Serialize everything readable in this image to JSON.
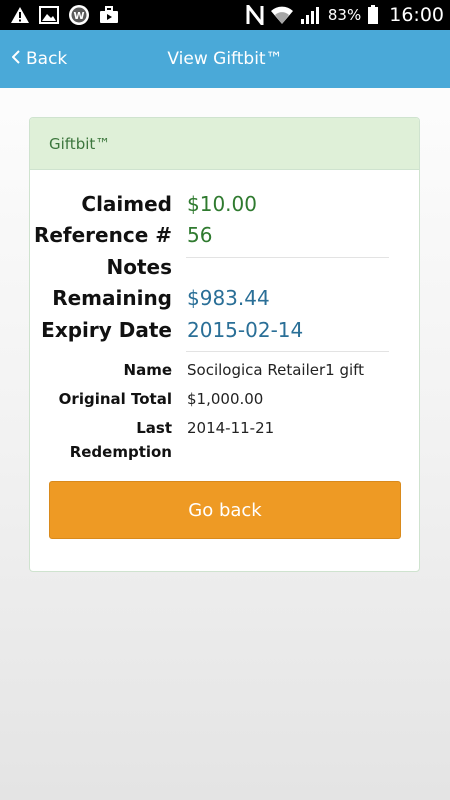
{
  "status_bar": {
    "battery_percent": "83%",
    "time": "16:00",
    "left_icons": [
      "warning-icon",
      "image-icon",
      "wordpress-icon",
      "briefcase-icon"
    ],
    "right_icons": [
      "nfc-icon",
      "wifi-icon",
      "signal-icon",
      "battery-icon"
    ]
  },
  "header": {
    "back_label": "Back",
    "title": "View Giftbit™",
    "background_color": "#4aa9d8"
  },
  "card": {
    "title": "Giftbit™",
    "fields": {
      "claimed": {
        "label": "Claimed",
        "value": "$10.00"
      },
      "reference": {
        "label": "Reference #",
        "value": "56"
      },
      "notes": {
        "label": "Notes",
        "value": ""
      },
      "remaining": {
        "label": "Remaining",
        "value": "$983.44"
      },
      "expiry": {
        "label": "Expiry Date",
        "value": "2015-02-14"
      }
    },
    "details": {
      "name": {
        "label": "Name",
        "value": "Socilogica Retailer1 gift"
      },
      "original_total": {
        "label": "Original Total",
        "value": "$1,000.00"
      },
      "last_redemption": {
        "label_line1": "Last",
        "label_line2": "Redemption",
        "value": "2014-11-21"
      }
    },
    "button_label": "Go back",
    "button_color": "#ee9a24"
  }
}
